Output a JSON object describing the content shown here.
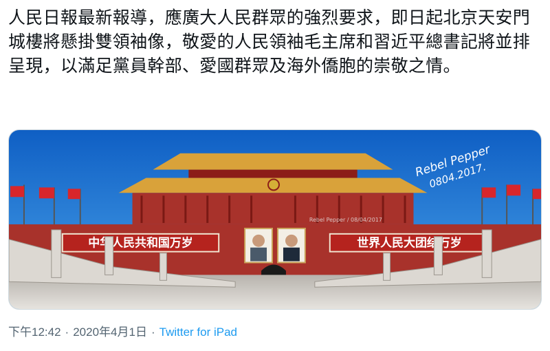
{
  "tweet": {
    "text": "人民日報最新報導，應廣大人民群眾的強烈要求，即日起北京天安門城樓將懸掛雙領袖像，敬愛的人民領袖毛主席和習近平總書記將並排呈現，以滿足黨員幹部、愛國群眾及海外僑胞的崇敬之情。",
    "time": "下午12:42",
    "date": "2020年4月1日",
    "separator": "·",
    "source": "Twitter for iPad"
  },
  "image": {
    "banner_left": "中华人民共和国万岁",
    "banner_right": "世界人民大团结万岁",
    "watermark": "Rebel Pepper / 08/04/2017",
    "signature_line1": "Rebel Pepper",
    "signature_line2": "0804.2017."
  },
  "colors": {
    "link": "#1d9bf0",
    "meta": "#536471",
    "sky": "#1c7fd6",
    "wall": "#a8322b",
    "roof": "#d9a23a"
  }
}
